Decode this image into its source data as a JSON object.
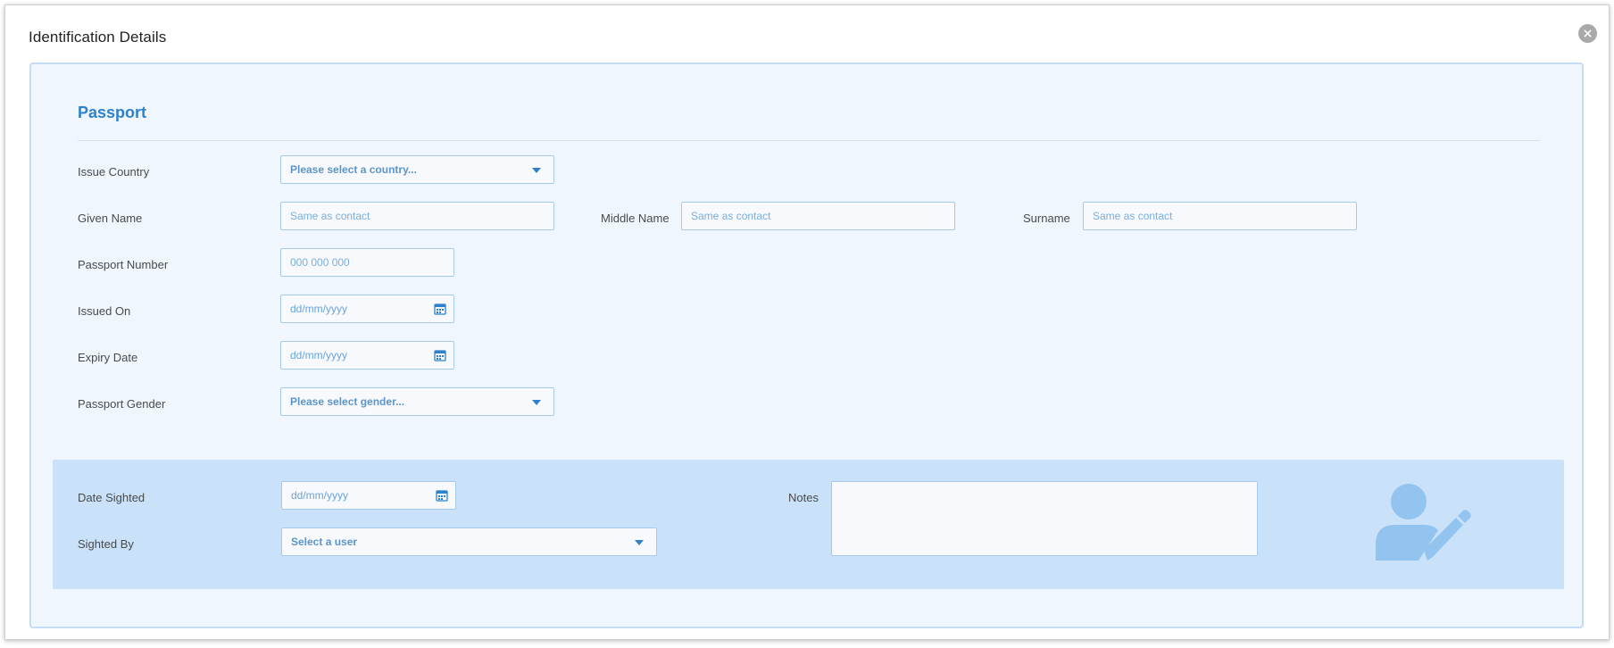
{
  "dialog": {
    "title": "Identification Details",
    "close_icon": "close-icon"
  },
  "passport": {
    "section_title": "Passport",
    "issue_country": {
      "label": "Issue Country",
      "placeholder": "Please select a country..."
    },
    "given_name": {
      "label": "Given Name",
      "placeholder": "Same as contact"
    },
    "middle_name": {
      "label": "Middle Name",
      "placeholder": "Same as contact"
    },
    "surname": {
      "label": "Surname",
      "placeholder": "Same as contact"
    },
    "passport_number": {
      "label": "Passport Number",
      "placeholder": "000 000 000"
    },
    "issued_on": {
      "label": "Issued On",
      "placeholder": "dd/mm/yyyy"
    },
    "expiry_date": {
      "label": "Expiry Date",
      "placeholder": "dd/mm/yyyy"
    },
    "passport_gender": {
      "label": "Passport Gender",
      "placeholder": "Please select gender..."
    }
  },
  "sighting": {
    "date_sighted": {
      "label": "Date Sighted",
      "placeholder": "dd/mm/yyyy"
    },
    "sighted_by": {
      "label": "Sighted By",
      "placeholder": "Select a user"
    },
    "notes": {
      "label": "Notes",
      "value": ""
    },
    "illustration_icon": "user-edit-icon"
  },
  "colors": {
    "accent": "#2d82cd",
    "panel_bg": "#f0f6fd",
    "panel_border": "#c4dcf4",
    "sighted_bg": "#c9e2fa",
    "field_border": "#a9c9e8",
    "illustration": "#93c3ef"
  }
}
